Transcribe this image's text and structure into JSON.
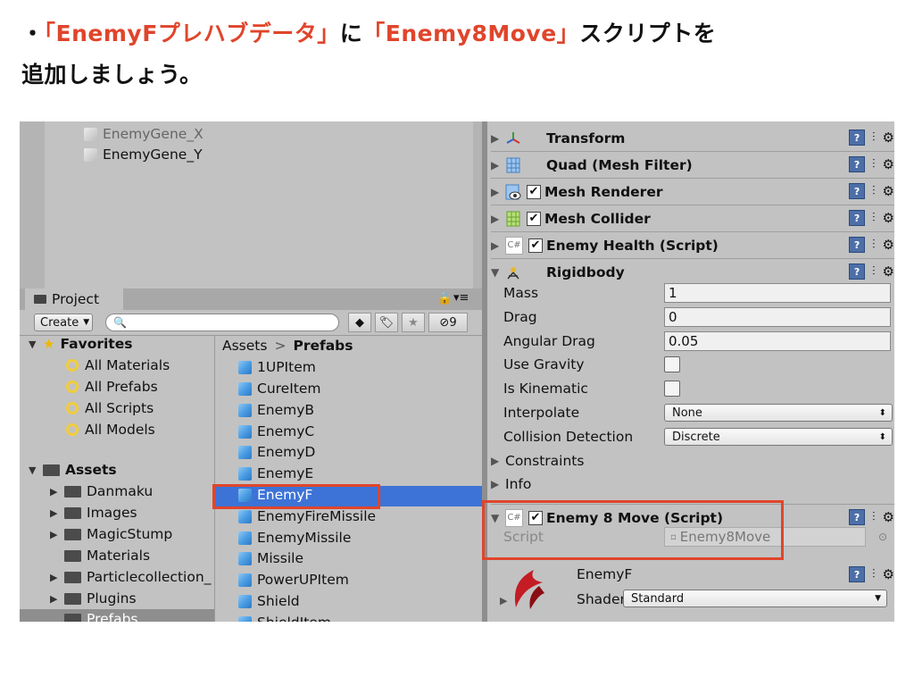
{
  "caption": {
    "bullet": "・",
    "quote1": "「EnemyFプレハブデータ」",
    "connector": "に",
    "quote2": "「Enemy8Move」",
    "rest": "スクリプトを",
    "line2": "追加しましょう。"
  },
  "hierarchy": {
    "items": [
      {
        "label": "EnemyGene_X"
      },
      {
        "label": "EnemyGene_Y"
      }
    ]
  },
  "project": {
    "tab_label": "Project",
    "create_label": "Create",
    "search_placeholder": "",
    "hidden_count": "9",
    "favorites": {
      "label": "Favorites",
      "items": [
        "All Materials",
        "All Prefabs",
        "All Scripts",
        "All Models"
      ]
    },
    "assets": {
      "label": "Assets",
      "folders": [
        "Danmaku",
        "Images",
        "MagicStump",
        "Materials",
        "Particlecollection_",
        "Plugins",
        "Prefabs"
      ]
    },
    "breadcrumb": {
      "root": "Assets",
      "current": "Prefabs"
    },
    "prefab_items": [
      "1UPItem",
      "CureItem",
      "EnemyB",
      "EnemyC",
      "EnemyD",
      "EnemyE",
      "EnemyF",
      "EnemyFireMissile",
      "EnemyMissile",
      "Missile",
      "PowerUPItem",
      "Shield",
      "ShieldItem"
    ],
    "selected_item": "EnemyF"
  },
  "inspector": {
    "components": [
      {
        "name": "Transform",
        "checkbox": false,
        "icon": "transform-icon"
      },
      {
        "name": "Quad (Mesh Filter)",
        "checkbox": false,
        "icon": "mesh-filter-icon"
      },
      {
        "name": "Mesh Renderer",
        "checkbox": true,
        "icon": "mesh-renderer-icon"
      },
      {
        "name": "Mesh Collider",
        "checkbox": true,
        "icon": "mesh-collider-icon"
      },
      {
        "name": "Enemy Health (Script)",
        "checkbox": true,
        "icon": "csharp-script-icon"
      }
    ],
    "rigidbody": {
      "name": "Rigidbody",
      "mass_label": "Mass",
      "mass": "1",
      "drag_label": "Drag",
      "drag": "0",
      "angular_drag_label": "Angular Drag",
      "angular_drag": "0.05",
      "use_gravity_label": "Use Gravity",
      "is_kinematic_label": "Is Kinematic",
      "interpolate_label": "Interpolate",
      "interpolate": "None",
      "collision_label": "Collision Detection",
      "collision": "Discrete",
      "constraints_label": "Constraints",
      "info_label": "Info"
    },
    "enemy8move": {
      "name": "Enemy 8 Move (Script)",
      "script_label": "Script",
      "script_value": "Enemy8Move"
    },
    "material": {
      "name": "EnemyF",
      "shader_label": "Shader",
      "shader_value": "Standard"
    }
  },
  "colors": {
    "highlight": "#e0452b",
    "selection": "#3d73d6",
    "panel": "#c2c2c2"
  }
}
